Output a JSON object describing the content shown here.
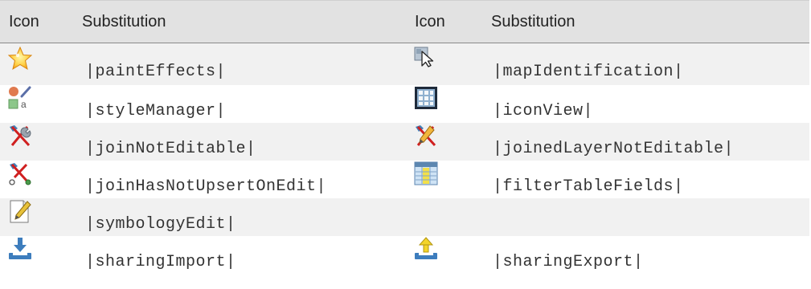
{
  "table": {
    "headers": [
      "Icon",
      "Substitution",
      "Icon",
      "Substitution"
    ],
    "rows": [
      {
        "left_icon": "star-effects-icon",
        "left": "|paintEffects|",
        "right_icon": "map-identify-cursor-icon",
        "right": "|mapIdentification|"
      },
      {
        "left_icon": "style-manager-icon",
        "left": "|styleManager|",
        "right_icon": "icon-view-grid-icon",
        "right": "|iconView|"
      },
      {
        "left_icon": "join-wrench-icon",
        "left": "|joinNotEditable|",
        "right_icon": "join-pencil-icon",
        "right": "|joinedLayerNotEditable|"
      },
      {
        "left_icon": "join-upsert-icon",
        "left": "|joinHasNotUpsertOnEdit|",
        "right_icon": "filter-table-fields-icon",
        "right": "|filterTableFields|"
      },
      {
        "left_icon": "symbology-edit-icon",
        "left": "|symbologyEdit|",
        "right_icon": "",
        "right": ""
      },
      {
        "left_icon": "sharing-import-icon",
        "left": "|sharingImport|",
        "right_icon": "sharing-export-icon",
        "right": "|sharingExport|"
      }
    ]
  },
  "colors": {
    "header_bg": "#e2e2e2",
    "row_odd_bg": "#f1f1f1",
    "row_even_bg": "#ffffff",
    "text": "#333333"
  }
}
